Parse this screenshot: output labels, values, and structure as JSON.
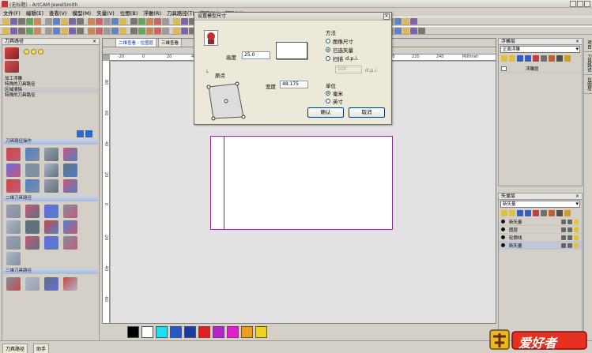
{
  "window": {
    "title": "(无标题) - ArtCAM JewelSmith"
  },
  "menu": [
    "文件(F)",
    "编辑(E)",
    "查看(V)",
    "模型(M)",
    "矢量(V)",
    "位图(B)",
    "浮雕(R)",
    "刀具路径(T)",
    "窗口(W)",
    "帮助(H)"
  ],
  "left_panel": {
    "title": "刀具路径",
    "items": [
      "加工浮雕",
      "特殊的刀具路径",
      "区域清除",
      "特殊的刀具路径"
    ],
    "sections": [
      "刀具路径操作",
      "二维刀具路径",
      "三维刀具路径",
      "三维刀具路径"
    ]
  },
  "doc": {
    "tabs": [
      "二维查看 - 位图层",
      "三维查看"
    ],
    "ruler_h": [
      "-20",
      "0",
      "20",
      "40",
      "60",
      "80",
      "100",
      "120",
      "140",
      "160",
      "180",
      "200",
      "220",
      "240",
      "260",
      "280",
      "300"
    ],
    "ruler_v": [
      "80",
      "60",
      "40",
      "20",
      "0",
      "-20",
      "-40",
      "-60"
    ],
    "ruler_unit": "Millimet"
  },
  "right_top": {
    "title": "浮雕层",
    "combo": "正面浮雕",
    "row": "浮雕层"
  },
  "right_bottom": {
    "title": "矢量层",
    "combo": "新矢量",
    "rows": [
      "新矢量",
      "图层",
      "轮廓线",
      "新矢量"
    ]
  },
  "side_tabs": [
    "项目",
    "刀具路径",
    "位图层"
  ],
  "palette": {
    "colors": [
      "#000000",
      "#ffffff",
      "#20e0f0",
      "#2858c8",
      "#1c3c9c",
      "#e02020",
      "#b028c8",
      "#e020d0",
      "#e8a020",
      "#f0d020"
    ]
  },
  "status": {
    "tabs": [
      "刀具路径",
      "助手"
    ]
  },
  "logo": {
    "text": "爱好者"
  },
  "dialog": {
    "title": "设置模型尺寸",
    "height_label": "高度",
    "height_value": "25.0",
    "width_label": "宽度",
    "width_value": "48.175",
    "origin_label": "原点",
    "method_title": "方法",
    "methods": [
      "图像尺寸",
      "已选矢量",
      "扫描"
    ],
    "dpi_suffix": "d.p.i.",
    "dpi_value": "100",
    "dpi_unit": "d.p.i.",
    "unit_title": "单位",
    "units": [
      "毫米",
      "英寸"
    ],
    "ok": "确认",
    "cancel": "取消"
  }
}
